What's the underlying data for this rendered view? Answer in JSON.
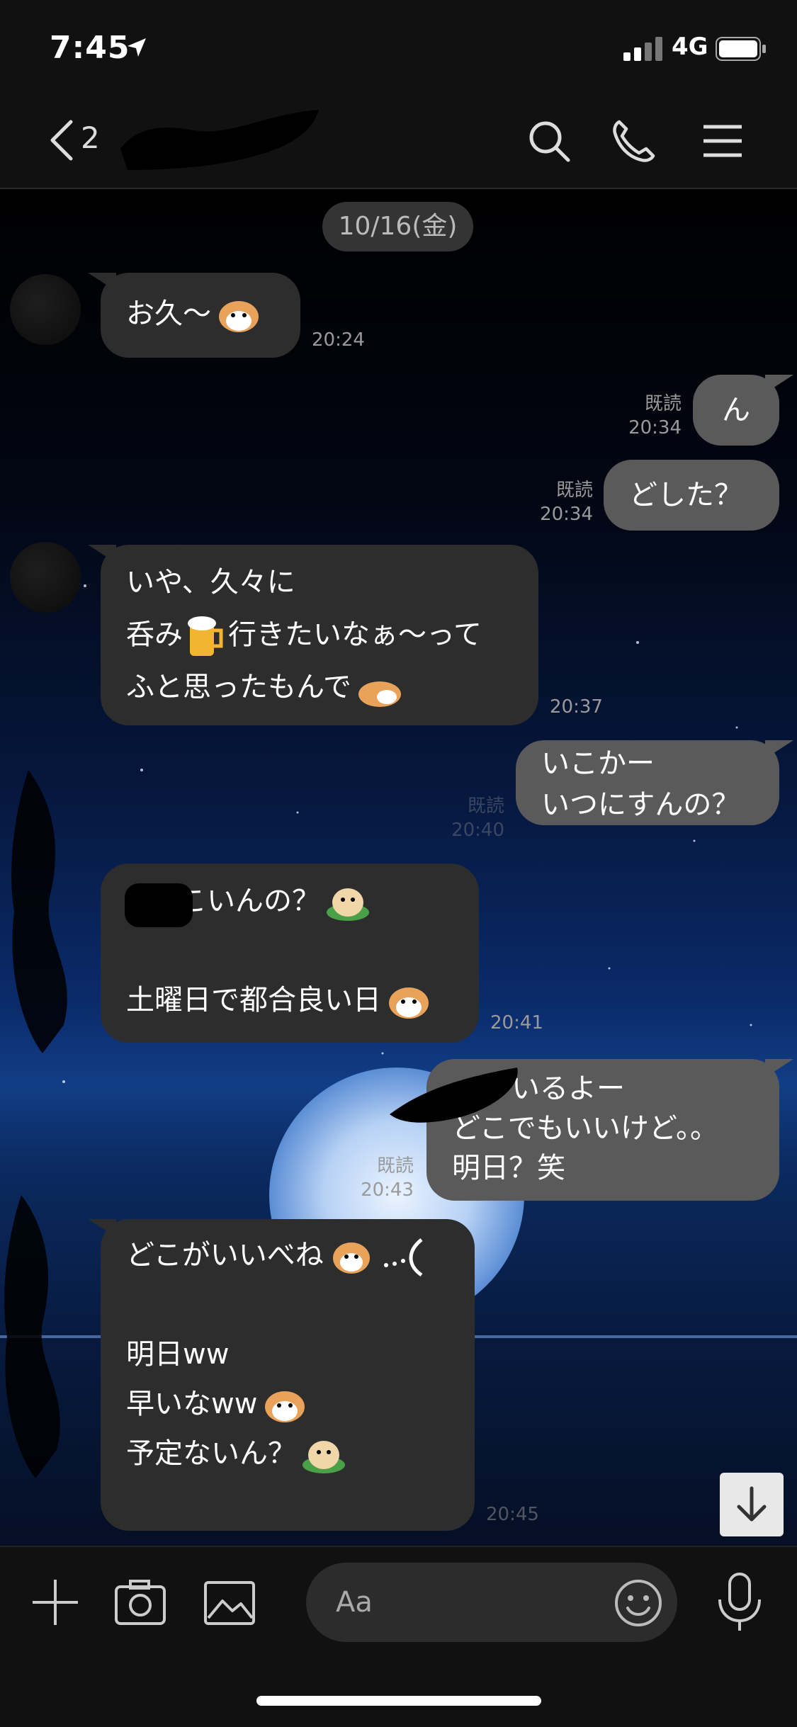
{
  "status_bar": {
    "time": "7:45",
    "network": "4G"
  },
  "header": {
    "unread_count": "2"
  },
  "date_chip": "10/16(金)",
  "messages": [
    {
      "side": "in",
      "lines": [
        "お久〜"
      ],
      "time": "20:24"
    },
    {
      "side": "out",
      "lines": [
        "ん"
      ],
      "read": "既読",
      "time": "20:34"
    },
    {
      "side": "out",
      "lines": [
        "どした？"
      ],
      "read": "既読",
      "time": "20:34"
    },
    {
      "side": "in",
      "lines": [
        "いや、久々に",
        "呑み",
        "行きたいなぁ〜って",
        "ふと思ったもんで"
      ],
      "time": "20:37"
    },
    {
      "side": "out",
      "lines": [
        "いこかー",
        "いつにすんの？"
      ],
      "read": "既読",
      "time": "20:40"
    },
    {
      "side": "in",
      "lines": [
        "こいんの？",
        "",
        "土曜日で都合良い日"
      ],
      "time": "20:41"
    },
    {
      "side": "out",
      "lines": [
        "いるよー",
        "どこでもいいけど。。",
        "明日？笑"
      ],
      "read": "既読",
      "time": "20:43"
    },
    {
      "side": "in",
      "lines": [
        "どこがいいべね",
        "",
        "明日ww",
        "早いなww",
        "予定ないん？"
      ],
      "time": "20:45"
    }
  ],
  "input": {
    "placeholder": "Aa"
  },
  "icons": {
    "header": [
      "back-chevron-icon",
      "search-icon",
      "phone-icon",
      "menu-icon"
    ],
    "bottom": [
      "plus-icon",
      "camera-icon",
      "image-icon",
      "emoji-icon",
      "microphone-icon"
    ],
    "scroll": "arrow-down-icon"
  }
}
